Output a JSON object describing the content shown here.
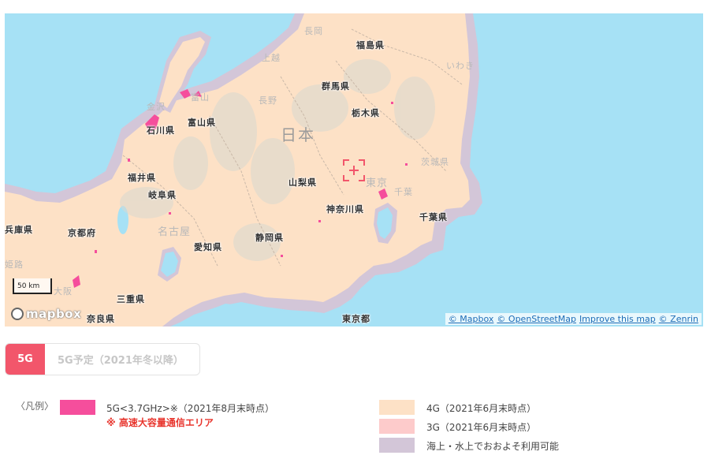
{
  "map": {
    "labels": {
      "nagaoka": "長岡",
      "fukushima": "福島県",
      "joetsu": "上越",
      "iwaki": "いわき",
      "gunma": "群馬県",
      "nagano": "長野",
      "kanazawa": "金沢",
      "toyama": "富山",
      "tochigi": "栃木県",
      "toyama_pref": "富山県",
      "ishikawa": "石川県",
      "japan": "日本",
      "ibaraki": "茨城県",
      "fukui": "福井県",
      "yamanashi": "山梨県",
      "tokyo": "東京",
      "gifu": "岐阜県",
      "chiba": "千葉",
      "kanagawa": "神奈川県",
      "chiba_pref": "千葉県",
      "hyogo": "兵庫県",
      "kyoto": "京都府",
      "nagoya": "名古屋",
      "aichi": "愛知県",
      "shizuoka": "静岡県",
      "himeji": "姫路",
      "osaka": "大阪",
      "mie": "三重県",
      "nara": "奈良県",
      "tokyo_to": "東京都"
    },
    "scale_label": "50 km",
    "logo_text": "mapbox",
    "attribution": [
      "© Mapbox",
      "© OpenStreetMap",
      "Improve this map",
      "© Zenrin"
    ]
  },
  "tabs": {
    "active": "5G",
    "inactive": "5G予定（2021年冬以降）"
  },
  "legend": {
    "title": "〈凡例〉",
    "items": {
      "g5": "5G<3.7GHz>※（2021年8月末時点）",
      "g5_note": "※ 高速大容量通信エリア",
      "g4": "4G（2021年6月末時点）",
      "g3": "3G（2021年6月末時点）",
      "sea": "海上・水上でおおよそ利用可能"
    },
    "colors": {
      "g5": "#f54e9c",
      "g4": "#fde1c6",
      "g3": "#fdcbcb",
      "sea": "#d3c6d8",
      "water": "#a6e1f5"
    }
  }
}
